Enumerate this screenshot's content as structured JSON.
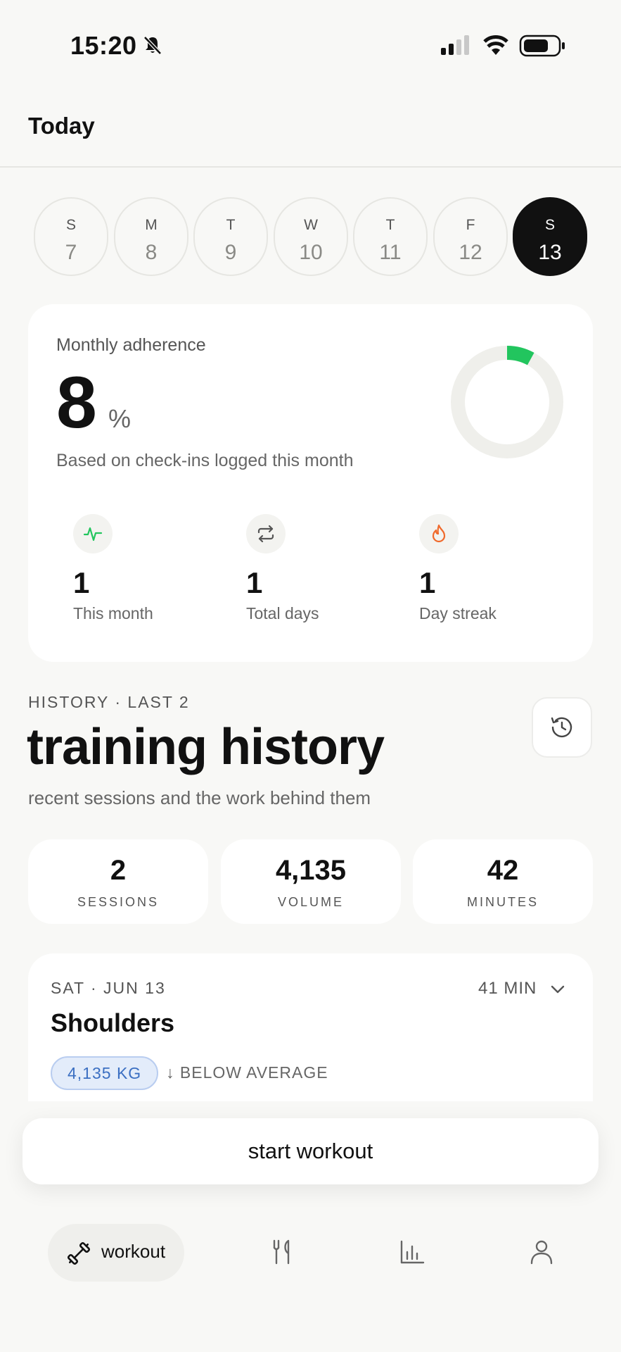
{
  "status_bar": {
    "time": "15:20",
    "icons": [
      "bell-muted-icon",
      "signal-icon",
      "wifi-icon",
      "battery-icon"
    ]
  },
  "header": {
    "title": "Today"
  },
  "days": [
    {
      "letter": "S",
      "num": "7"
    },
    {
      "letter": "M",
      "num": "8"
    },
    {
      "letter": "T",
      "num": "9"
    },
    {
      "letter": "W",
      "num": "10"
    },
    {
      "letter": "T",
      "num": "11"
    },
    {
      "letter": "F",
      "num": "12"
    },
    {
      "letter": "S",
      "num": "13",
      "selected": true
    }
  ],
  "adherence": {
    "label": "Monthly adherence",
    "value": "8",
    "unit": "%",
    "fraction": 0.08,
    "subtitle": "Based on check-ins logged this month",
    "ring_color": "#22c55e",
    "stats": [
      {
        "icon": "activity-icon",
        "value": "1",
        "label": "This month"
      },
      {
        "icon": "repeat-icon",
        "value": "1",
        "label": "Total days"
      },
      {
        "icon": "flame-icon",
        "value": "1",
        "label": "Day streak"
      }
    ]
  },
  "history": {
    "kicker": "HISTORY · LAST 2",
    "title": "training history",
    "subtitle": "recent sessions and the work behind them",
    "button_icon": "history-icon",
    "metrics": [
      {
        "value": "2",
        "label": "SESSIONS"
      },
      {
        "value": "4,135",
        "label": "VOLUME"
      },
      {
        "value": "42",
        "label": "MINUTES"
      }
    ]
  },
  "session": {
    "date": "SAT · JUN 13",
    "duration": "41 MIN",
    "name": "Shoulders",
    "volume": "4,135 KG",
    "flag": "↓ BELOW AVERAGE"
  },
  "start_button": "start workout",
  "nav": {
    "active_label": "workout",
    "items": [
      "dumbbell-icon",
      "utensils-icon",
      "chart-icon",
      "profile-icon"
    ]
  }
}
